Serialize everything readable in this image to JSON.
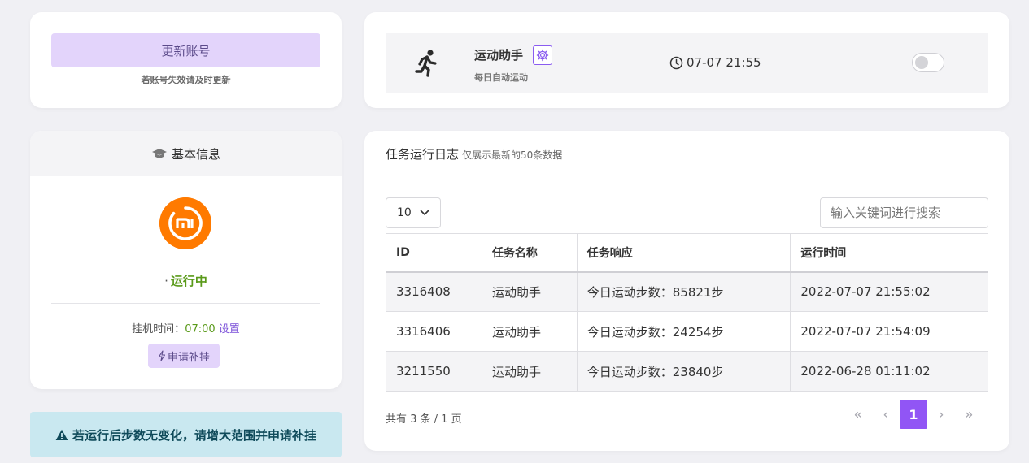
{
  "account": {
    "update_label": "更新账号",
    "hint": "若账号失效请及时更新"
  },
  "task": {
    "title": "运动助手",
    "subtitle": "每日自动运动",
    "time": "07-07 21:55",
    "enabled": false
  },
  "info": {
    "header": "基本信息",
    "status": "运行中",
    "status_prefix": "·",
    "hang_label": "挂机时间：",
    "hang_time": "07:00",
    "hang_set": "设置",
    "apply_label": "申请补挂"
  },
  "alert": {
    "text": "若运行后步数无变化，请增大范围并申请补挂"
  },
  "log": {
    "title": "任务运行日志",
    "subtitle": "仅展示最新的50条数据",
    "page_size": "10",
    "search_placeholder": "输入关键词进行搜索",
    "columns": [
      "ID",
      "任务名称",
      "任务响应",
      "运行时间"
    ],
    "rows": [
      [
        "3316408",
        "运动助手",
        "今日运动步数：85821步",
        "2022-07-07 21:55:02"
      ],
      [
        "3316406",
        "运动助手",
        "今日运动步数：24254步",
        "2022-07-07 21:54:09"
      ],
      [
        "3211550",
        "运动助手",
        "今日运动步数：23840步",
        "2022-06-28 01:11:02"
      ]
    ],
    "summary": "共有 3 条 / 1 页",
    "current_page": "1"
  },
  "colors": {
    "accent": "#9155f5",
    "accent_light": "#e3d4fb",
    "running_green": "#5a9a1a",
    "brand_orange": "#ff7a00",
    "alert_bg": "#c9e8f0"
  }
}
